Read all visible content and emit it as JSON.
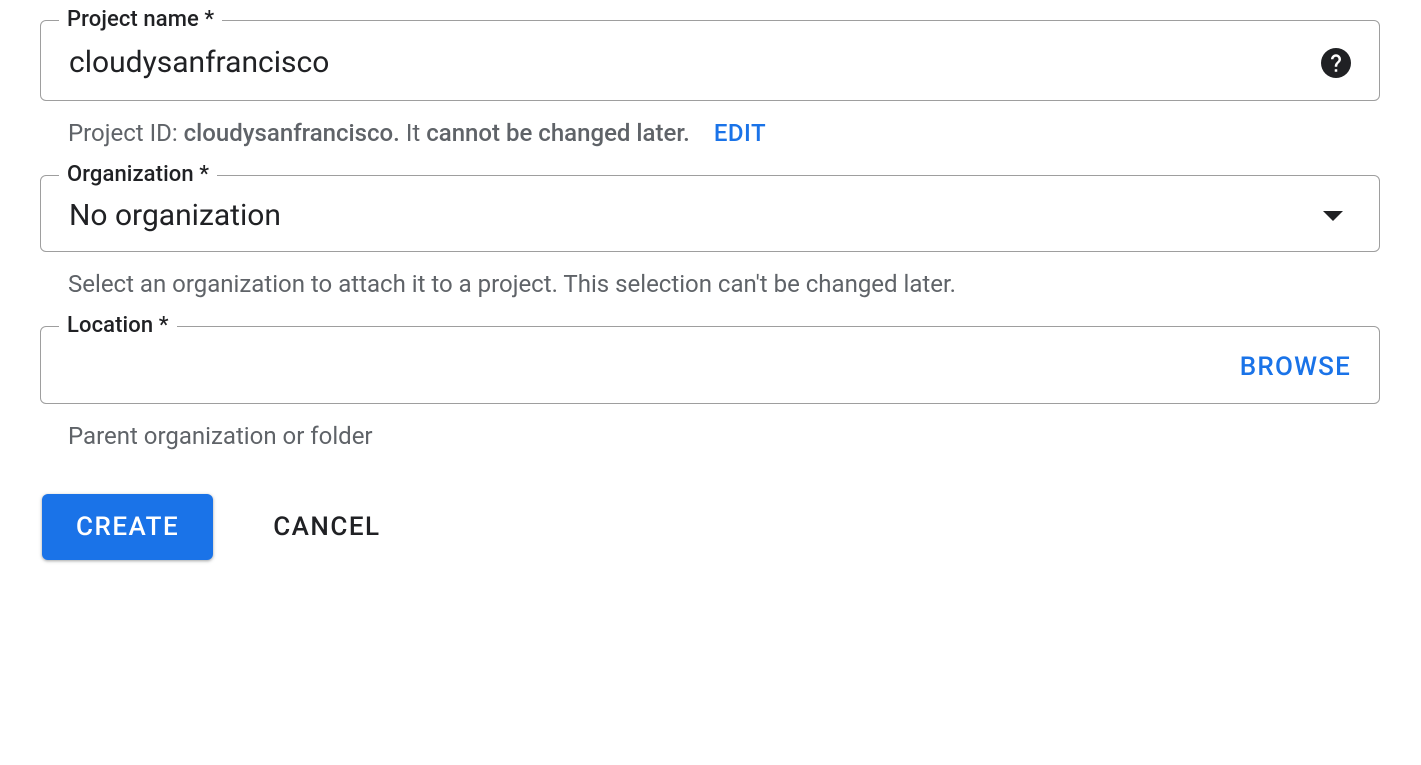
{
  "project_name": {
    "label": "Project name *",
    "value": "cloudysanfrancisco",
    "helper_prefix": "Project ID:",
    "helper_id": "cloudysanfrancisco.",
    "helper_mid": "It",
    "helper_bold": "cannot be changed later.",
    "edit_label": "EDIT"
  },
  "organization": {
    "label": "Organization *",
    "value": "No organization",
    "helper": "Select an organization to attach it to a project. This selection can't be changed later."
  },
  "location": {
    "label": "Location *",
    "value": "",
    "browse_label": "BROWSE",
    "helper": "Parent organization or folder"
  },
  "buttons": {
    "create": "CREATE",
    "cancel": "CANCEL"
  }
}
